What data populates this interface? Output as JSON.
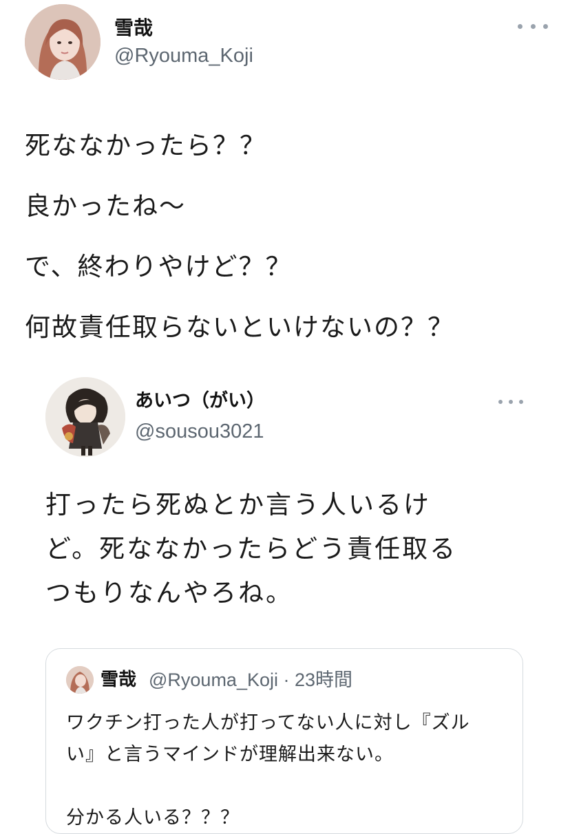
{
  "main_tweet": {
    "display_name": "雪哉",
    "handle": "@Ryouma_Koji",
    "avatar_icon": "profile-photo-avatar",
    "more_icon": "more-options-icon",
    "lines": [
      "死ななかったら？？",
      "良かったね〜",
      "で、終わりやけど？？",
      "何故責任取らないといけないの？？"
    ]
  },
  "quoted_tweet": {
    "display_name": "あいつ（がい）",
    "handle": "@sousou3021",
    "avatar_icon": "anime-character-avatar",
    "more_icon": "more-options-icon",
    "lines": [
      "打ったら死ぬとか言う人いるけ",
      "ど。死ななかったらどう責任取る",
      "つもりなんやろね。"
    ]
  },
  "nested_quote": {
    "display_name": "雪哉",
    "handle_time": "@Ryouma_Koji · 23時間",
    "avatar_icon": "profile-photo-avatar",
    "lines": [
      "ワクチン打った人が打ってない人に対し『ズル",
      "い』と言うマインドが理解出来ない。",
      "",
      "分かる人いる？？？"
    ]
  },
  "colors": {
    "text": "#141414",
    "secondary_text": "#5c6670",
    "border": "#d5dade",
    "more_dots": "#9aa3ad"
  }
}
